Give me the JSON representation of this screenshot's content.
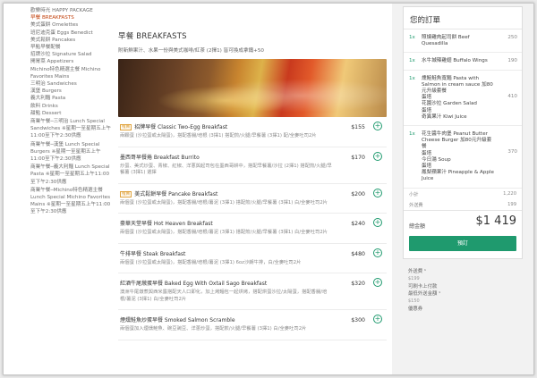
{
  "sidebar": {
    "items": [
      {
        "label": "歡樂時光 HAPPY PACKAGE",
        "active": false
      },
      {
        "label": "早餐 BREAKFASTS",
        "active": true
      },
      {
        "label": "美式蛋餅 Omelettes",
        "active": false
      },
      {
        "label": "班尼迪克蛋 Eggs Benedict",
        "active": false
      },
      {
        "label": "美式鬆餅 Pancakes",
        "active": false
      },
      {
        "label": "早點早餐配餐",
        "active": false
      },
      {
        "label": "招牌沙拉 Signature Salad",
        "active": false
      },
      {
        "label": "開胃菜 Appetizers",
        "active": false
      },
      {
        "label": "Michino特色精選主餐 Michino Favorites Mains",
        "active": false
      },
      {
        "label": "三明治 Sandwiches",
        "active": false
      },
      {
        "label": "漢堡 Burgers",
        "active": false
      },
      {
        "label": "義大利麵 Pasta",
        "active": false
      },
      {
        "label": "飲料 Drinks",
        "active": false
      },
      {
        "label": "甜點 Dessert",
        "active": false
      },
      {
        "label": "商業午餐─三明治 Lunch Special Sandwiches ※星期一至星期五上午11:00至下午2:30供應",
        "active": false
      },
      {
        "label": "商業午餐─漢堡 Lunch Special Burgers ※星期一至星期五上午11:00至下午2:30供應",
        "active": false
      },
      {
        "label": "商業午餐─義大利麵 Lunch Special Pasta ※星期一至星期五上午11:00至下午2:30供應",
        "active": false
      },
      {
        "label": "商業午餐─Michino特色精選主餐 Lunch Special Michino Favorites Mains ※星期一至星期五上午11:00至下午2:30供應",
        "active": false
      }
    ]
  },
  "menu": {
    "title": "早餐 BREAKFASTS",
    "description": "附新鮮果汁、水果一份與美式咖啡/紅茶 (2擇1) 皆可換成拿鐵+50",
    "badge_label": "推薦",
    "items": [
      {
        "name": "招牌早餐 Classic Two-Egg Breakfast",
        "badge": true,
        "desc": "兩顆蛋 (沙拉蛋或太陽蛋)，搭配香腸/培根 (3擇1) 搭配煎/火腿/早餐薯 (3擇1) 配/全麥吐司2片",
        "price": "$155"
      },
      {
        "name": "墨西哥早餐捲 Breakfast Burrito",
        "badge": false,
        "desc": "炒蛋、美式炒蛋、青椒、紅椒、洋蔥與起司包在墨西哥餅中，搭配早餐薯/沙拉 (2擇1) 搭配煎/火腿/早餐薯 (3擇1) 選擇",
        "price": "$170"
      },
      {
        "name": "美式鬆餅早餐 Pancake Breakfast",
        "badge": true,
        "desc": "兩個蛋 (沙拉蛋或太陽蛋)，搭配香腸/培根/薯泥 (3擇1) 搭配煎/火腿/早餐薯 (3擇1) 白/全麥吐司2片",
        "price": "$200"
      },
      {
        "name": "豪華天堂早餐 Hot Heaven Breakfast",
        "badge": false,
        "desc": "兩個蛋 (沙拉蛋或太陽蛋)，搭配香腸/培根/薯泥 (3擇1) 搭配煎/火腿/早餐薯 (3擇1) 白/全麥吐司2片",
        "price": "$240"
      },
      {
        "name": "牛排早餐 Steak Breakfast",
        "badge": false,
        "desc": "兩個蛋 (沙拉蛋或太陽蛋)，搭配香腸/培根/薯泥 (3擇1) 6oz沙朗牛排，白/全麥吐司2片",
        "price": "$480"
      },
      {
        "name": "紅酒牛尾燉蛋早餐 Baked Egg With Oxtail Sago Breakfast",
        "badge": false,
        "desc": "澳洲牛尾燉煮與西米露搭配天人口即化，加上烤麵包一起烘烤，搭配烘蛋沙拉/太陽蛋，搭配香腸/培根/薯泥 (3擇1) 白/全麥吐司2片",
        "price": "$320"
      },
      {
        "name": "煙燻鮭魚炒蛋早餐 Smoked Salmon Scramble",
        "badge": false,
        "desc": "兩個蛋加入煙燻鮭魚、碗豆豌豆、洋蔥炒蛋，搭配煎/火腿/早餐薯 (3擇1) 白/全麥吐司2片",
        "price": "$300"
      }
    ]
  },
  "order": {
    "title": "您的訂單",
    "items": [
      {
        "qty": "1x",
        "name": "照燒雞肉起司餅 Beef Quesadilla",
        "price": "250"
      },
      {
        "qty": "1x",
        "name": "水牛城辣雞翅 Buffalo Wings",
        "price": "190"
      },
      {
        "qty": "1x",
        "name": "燻鮭鮭魚寬麵 Pasta with Salmon in cream sauce 加80元升級套餐\n蛋塔\n花園沙拉 Garden Salad\n蛋塔\n奇異果汁 Kiwi Juice",
        "price": "410"
      },
      {
        "qty": "1x",
        "name": "花生醬牛肉堡 Peanut Butter Cheese Burger 加80元升級套餐\n蛋塔\n今日湯 Soup\n蛋塔\n鳳梨蘋果汁 Pineapple & Apple Juice",
        "price": "370"
      }
    ],
    "subtotal_label": "小計",
    "subtotal": "1,220",
    "delivery_label": "外送費",
    "delivery": "199",
    "total_label": "總金額",
    "total": "$1 419",
    "checkout_label": "預訂"
  },
  "meta": {
    "fee_label": "外送費 ¹",
    "fee_value": "$199",
    "payment_label": "可刷卡上付款",
    "min_label": "最低外送金額 ¹",
    "min_value": "$150",
    "coupon_label": "優惠券"
  },
  "colors": {
    "accent": "#1f9a6e",
    "active_nav": "#c2410c",
    "badge": "#e0a23a"
  }
}
